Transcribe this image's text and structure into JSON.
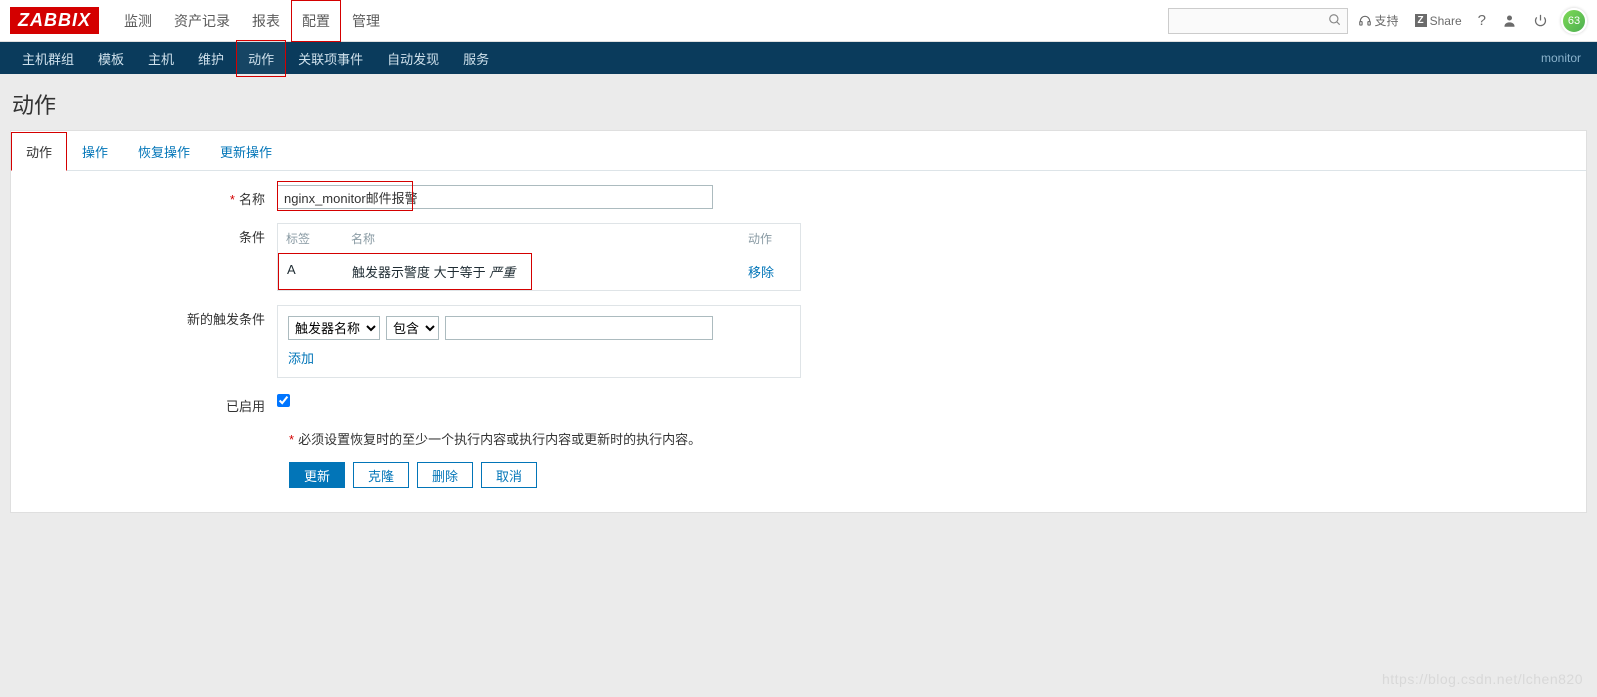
{
  "brand": "ZABBIX",
  "top_menu": [
    "监测",
    "资产记录",
    "报表",
    "配置",
    "管理"
  ],
  "top_menu_active_index": 3,
  "top_right": {
    "support": "支持",
    "share": "Share",
    "badge": "63"
  },
  "sub_menu": [
    "主机群组",
    "模板",
    "主机",
    "维护",
    "动作",
    "关联项事件",
    "自动发现",
    "服务"
  ],
  "sub_menu_active_index": 4,
  "sub_right": "monitor",
  "page_title": "动作",
  "tabs": [
    "动作",
    "操作",
    "恢复操作",
    "更新操作"
  ],
  "tabs_active_index": 0,
  "form": {
    "name_label": "名称",
    "name_value": "nginx_monitor邮件报警",
    "conditions_label": "条件",
    "conditions_header": {
      "tag": "标签",
      "name": "名称",
      "action": "动作"
    },
    "condition_rows": [
      {
        "tag": "A",
        "name_prefix": "触发器示警度 大于等于 ",
        "name_italic": "严重",
        "action": "移除"
      }
    ],
    "new_condition_label": "新的触发条件",
    "new_condition_type_options": [
      "触发器名称"
    ],
    "new_condition_op_options": [
      "包含"
    ],
    "new_condition_value": "",
    "add_link": "添加",
    "enabled_label": "已启用",
    "enabled_checked": true,
    "warning": "必须设置恢复时的至少一个执行内容或执行内容或更新时的执行内容。",
    "buttons": {
      "update": "更新",
      "clone": "克隆",
      "delete": "删除",
      "cancel": "取消"
    }
  },
  "watermark": "https://blog.csdn.net/lchen820"
}
